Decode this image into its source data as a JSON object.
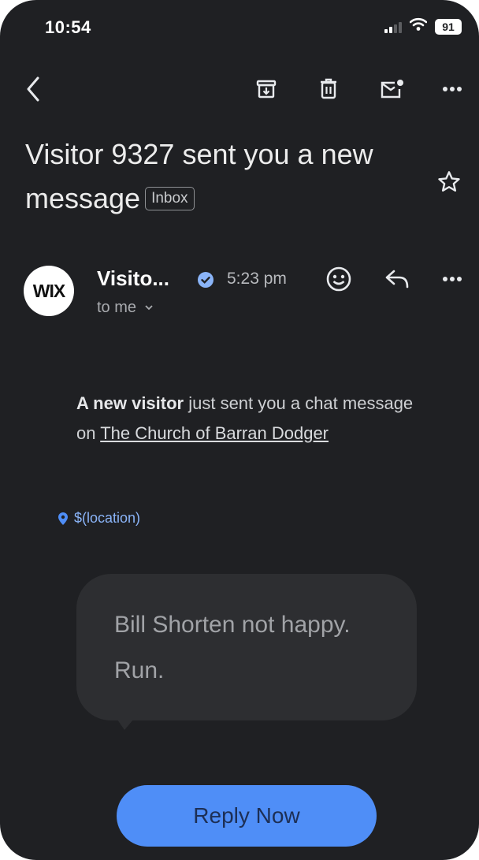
{
  "status_bar": {
    "time": "10:54",
    "battery": "91"
  },
  "toolbar": {
    "icons": [
      "back-arrow-icon",
      "archive-icon",
      "trash-icon",
      "mark-unread-icon",
      "more-icon"
    ]
  },
  "email": {
    "subject": "Visitor 9327 sent you a new message",
    "label": "Inbox",
    "sender": {
      "avatar_text": "WIX",
      "name": "Visito...",
      "time": "5:23 pm",
      "recipient": "to me"
    },
    "body": {
      "bold_lead": "A new visitor",
      "text": " just sent you a chat message on ",
      "link": "The Church of Barran Dodger"
    },
    "location": "$(location)",
    "chat_message": "Bill Shorten not happy. Run.",
    "reply_button": "Reply Now"
  },
  "colors": {
    "background": "#1f2023",
    "accent": "#4f8ef7",
    "bubble": "#2d2e31"
  }
}
